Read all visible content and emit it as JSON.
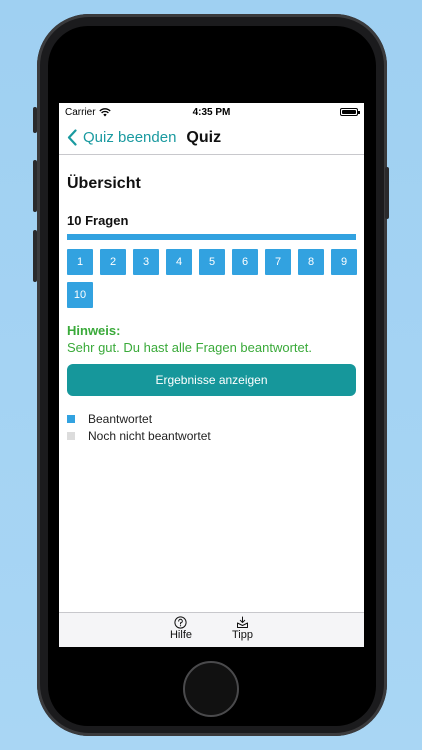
{
  "status": {
    "carrier": "Carrier",
    "time": "4:35 PM"
  },
  "nav": {
    "back_label": "Quiz beenden",
    "title": "Quiz"
  },
  "overview": {
    "title": "Übersicht",
    "question_count": "10 Fragen",
    "progress": 1.0
  },
  "questions": [
    "1",
    "2",
    "3",
    "4",
    "5",
    "6",
    "7",
    "8",
    "9",
    "10"
  ],
  "hint": {
    "title": "Hinweis:",
    "text": "Sehr gut. Du hast alle Fragen beantwortet."
  },
  "result_button": "Ergebnisse anzeigen",
  "legend": [
    {
      "label": "Beantwortet",
      "color": "#32a2e0"
    },
    {
      "label": "Noch nicht beantwortet",
      "color": "#dcdcdc"
    }
  ],
  "tabbar": {
    "help_label": "Hilfe",
    "tip_label": "Tipp"
  },
  "colors": {
    "accent": "#16979b",
    "answered": "#32a2e0",
    "hint": "#3aaa3a"
  }
}
